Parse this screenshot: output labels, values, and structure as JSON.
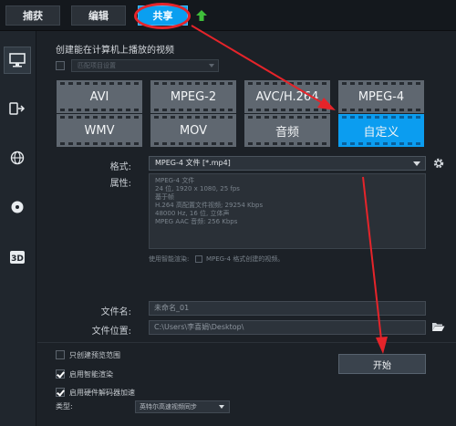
{
  "top_tabs": [
    {
      "label": "捕获"
    },
    {
      "label": "编辑"
    },
    {
      "label": "共享"
    }
  ],
  "sidebar_icons": [
    "monitor-icon",
    "device-icon",
    "globe-icon",
    "disc-icon",
    "3d-icon"
  ],
  "main": {
    "heading": "创建能在计算机上播放的视频",
    "dim_select_value": "匹配项目设置",
    "formats": [
      "AVI",
      "MPEG-2",
      "AVC/H.264",
      "MPEG-4",
      "WMV",
      "MOV",
      "音频",
      "自定义"
    ],
    "format_label": "格式:",
    "format_value": "MPEG-4 文件 [*.mp4]",
    "props_label": "属性:",
    "props_lines": [
      "MPEG-4 文件",
      "24 位, 1920 x 1080, 25 fps",
      "基于帧",
      "H.264 高配置文件视频; 29254 Kbps",
      "48000 Hz, 16 位, 立体声",
      "MPEG AAC 音频: 256 Kbps"
    ],
    "smart_render_text": "使用智能渲染:",
    "smart_render_hint": "MPEG-4 格式创建的视频。",
    "filename_label": "文件名:",
    "filename_value": "未命名_01",
    "location_label": "文件位置:",
    "location_value": "C:\\Users\\李喜娟\\Desktop\\",
    "options": [
      {
        "label": "只创建预览范围",
        "checked": false
      },
      {
        "label": "启用智能渲染",
        "checked": true
      },
      {
        "label": "启用硬件解码器加速",
        "checked": true
      }
    ],
    "start_label": "开始",
    "type_label": "类型:",
    "type_value": "英特尔高速视频同步"
  },
  "colors": {
    "accent": "#0b9df0",
    "annotation": "#e5242a",
    "background": "#1c2127"
  }
}
